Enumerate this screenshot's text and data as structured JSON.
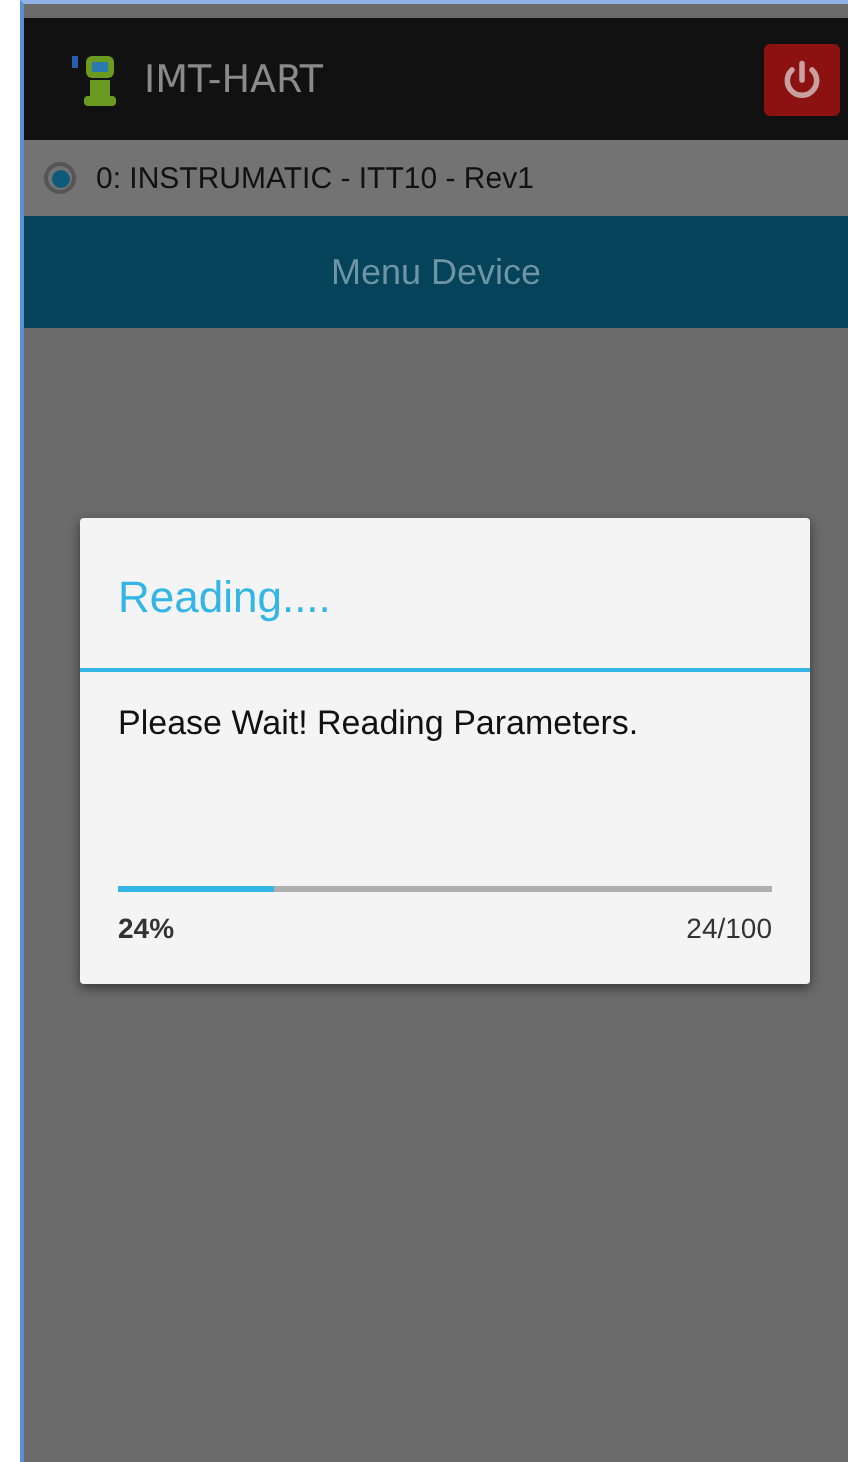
{
  "app_bar": {
    "title": "IMT-HART"
  },
  "devices": [
    {
      "label": "0: INSTRUMATIC - ITT10 - Rev1",
      "selected": true
    }
  ],
  "menu_header": {
    "title": "Menu Device"
  },
  "dialog": {
    "title": "Reading....",
    "message": "Please Wait! Reading Parameters.",
    "progress": {
      "level": 0.24,
      "percent": "24%",
      "count": "24/100"
    }
  }
}
